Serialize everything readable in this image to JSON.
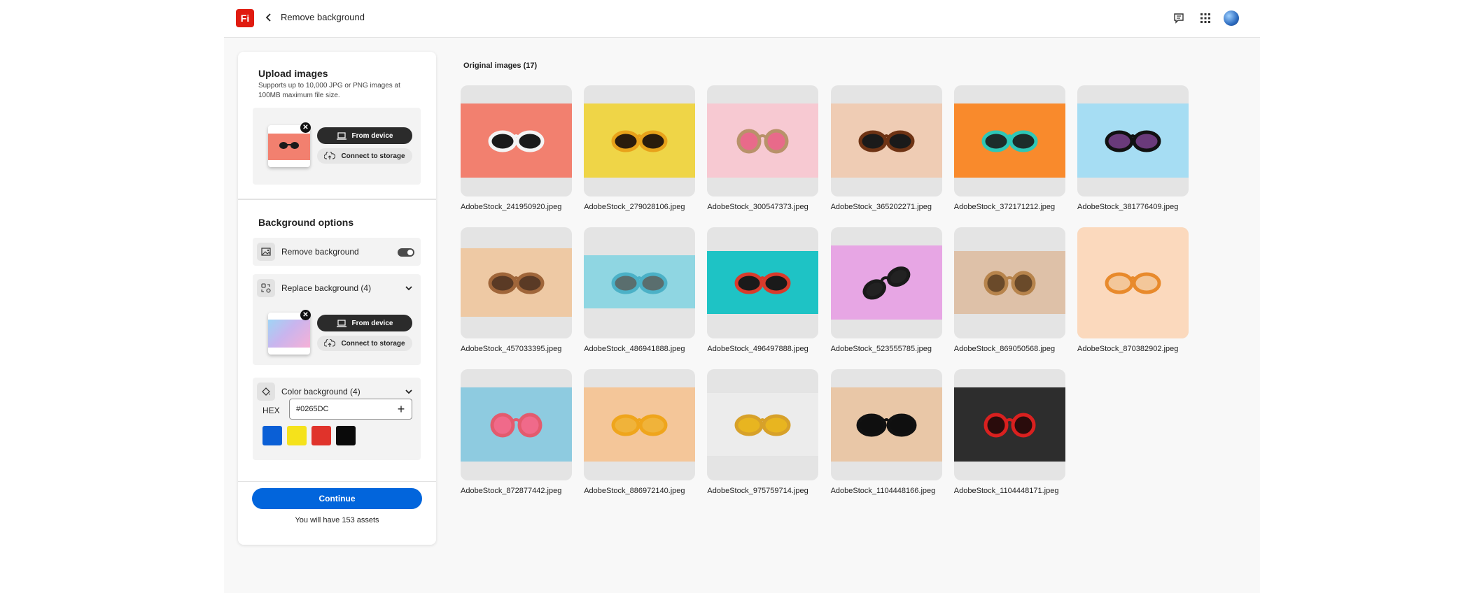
{
  "header": {
    "logo_text": "Fi",
    "title": "Remove background",
    "icons": [
      "chat-icon",
      "apps-grid-icon",
      "avatar"
    ]
  },
  "upload": {
    "title": "Upload images",
    "description": "Supports up to 10,000 JPG or PNG images at 100MB maximum file size.",
    "from_device": "From device",
    "connect_storage": "Connect to storage"
  },
  "background_options": {
    "title": "Background options",
    "remove_label": "Remove background",
    "remove_enabled": true,
    "replace_label": "Replace background (4)",
    "replace_from_device": "From device",
    "replace_connect_storage": "Connect to storage",
    "color_label": "Color background (4)",
    "hex_label": "HEX",
    "hex_value": "#0265DC",
    "swatches": [
      "#0a5fd6",
      "#f5e21b",
      "#e0332b",
      "#0a0a0a"
    ]
  },
  "footer": {
    "continue_label": "Continue",
    "assets_text": "You will have 153 assets"
  },
  "colors": {
    "accent": "#0265dc",
    "brand": "#e01b10"
  },
  "gallery": {
    "title": "Original images (17)",
    "items": [
      {
        "name": "AdobeStock_241950920.jpeg",
        "bg": "#f2806f",
        "frame": "#f4f4f4",
        "lens": "#1a1a1a",
        "shape": "wide"
      },
      {
        "name": "AdobeStock_279028106.jpeg",
        "bg": "#efd547",
        "frame": "#e8a21a",
        "lens": "#2a1c0c",
        "shape": "wide"
      },
      {
        "name": "AdobeStock_300547373.jpeg",
        "bg": "#f7c9d2",
        "frame": "#b8926a",
        "lens": "#e86a8a",
        "shape": "round"
      },
      {
        "name": "AdobeStock_365202271.jpeg",
        "bg": "#efccb4",
        "frame": "#6e3314",
        "lens": "#1a1a1a",
        "shape": "wide"
      },
      {
        "name": "AdobeStock_372171212.jpeg",
        "bg": "#f98a2c",
        "frame": "#2ec7b7",
        "lens": "#1d2d2b",
        "shape": "wide"
      },
      {
        "name": "AdobeStock_381776409.jpeg",
        "bg": "#a6ddf3",
        "frame": "#111111",
        "lens": "#6a3a7a",
        "shape": "wide"
      },
      {
        "name": "AdobeStock_457033395.jpeg",
        "bg": "#eec9a4",
        "frame": "#a0663a",
        "lens": "#5a3a25",
        "shape": "wide"
      },
      {
        "name": "AdobeStock_486941888.jpeg",
        "bg": "#8fd6e2",
        "frame": "#4bb1c7",
        "lens": "#5a6e6e",
        "shape": "wide"
      },
      {
        "name": "AdobeStock_496497888.jpeg",
        "bg": "#1ec3c5",
        "frame": "#d83b2c",
        "lens": "#1a1a1a",
        "shape": "wide"
      },
      {
        "name": "AdobeStock_523555785.jpeg",
        "bg": "#e7a6e4",
        "frame": "#1a1a1a",
        "lens": "#222222",
        "shape": "tilt"
      },
      {
        "name": "AdobeStock_869050568.jpeg",
        "bg": "#dec1a8",
        "frame": "#b7844c",
        "lens": "#6a4a2a",
        "shape": "round"
      },
      {
        "name": "AdobeStock_870382902.jpeg",
        "bg": "#fbd9bd",
        "frame": "#e88a2c",
        "lens": "#f3c79a",
        "shape": "wide"
      },
      {
        "name": "AdobeStock_872877442.jpeg",
        "bg": "#8ecbe0",
        "frame": "#e35b6e",
        "lens": "#f06a8a",
        "shape": "round"
      },
      {
        "name": "AdobeStock_886972140.jpeg",
        "bg": "#f4c699",
        "frame": "#efa51c",
        "lens": "#f0b33a",
        "shape": "wide"
      },
      {
        "name": "AdobeStock_975759714.jpeg",
        "bg": "#ececec",
        "frame": "#d7a12a",
        "lens": "#e8b520",
        "shape": "wide"
      },
      {
        "name": "AdobeStock_1104448166.jpeg",
        "bg": "#e9c7a7",
        "frame": "#111111",
        "lens": "#0f0f0f",
        "shape": "cat"
      },
      {
        "name": "AdobeStock_1104448171.jpeg",
        "bg": "#2d2d2d",
        "frame": "#d9201f",
        "lens": "#2a0c0c",
        "shape": "round"
      }
    ]
  }
}
